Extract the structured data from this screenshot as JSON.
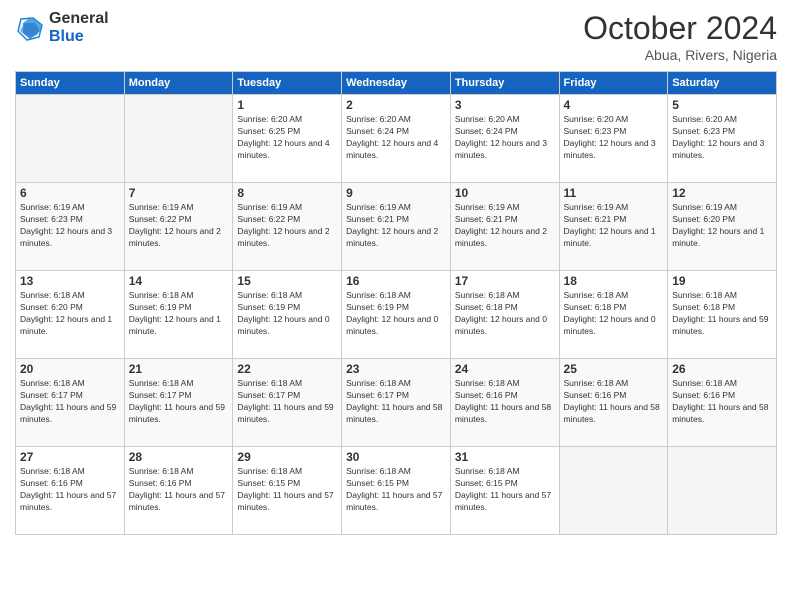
{
  "header": {
    "logo_general": "General",
    "logo_blue": "Blue",
    "month_title": "October 2024",
    "location": "Abua, Rivers, Nigeria"
  },
  "days_of_week": [
    "Sunday",
    "Monday",
    "Tuesday",
    "Wednesday",
    "Thursday",
    "Friday",
    "Saturday"
  ],
  "weeks": [
    [
      {
        "day": "",
        "info": ""
      },
      {
        "day": "",
        "info": ""
      },
      {
        "day": "1",
        "info": "Sunrise: 6:20 AM\nSunset: 6:25 PM\nDaylight: 12 hours and 4 minutes."
      },
      {
        "day": "2",
        "info": "Sunrise: 6:20 AM\nSunset: 6:24 PM\nDaylight: 12 hours and 4 minutes."
      },
      {
        "day": "3",
        "info": "Sunrise: 6:20 AM\nSunset: 6:24 PM\nDaylight: 12 hours and 3 minutes."
      },
      {
        "day": "4",
        "info": "Sunrise: 6:20 AM\nSunset: 6:23 PM\nDaylight: 12 hours and 3 minutes."
      },
      {
        "day": "5",
        "info": "Sunrise: 6:20 AM\nSunset: 6:23 PM\nDaylight: 12 hours and 3 minutes."
      }
    ],
    [
      {
        "day": "6",
        "info": "Sunrise: 6:19 AM\nSunset: 6:23 PM\nDaylight: 12 hours and 3 minutes."
      },
      {
        "day": "7",
        "info": "Sunrise: 6:19 AM\nSunset: 6:22 PM\nDaylight: 12 hours and 2 minutes."
      },
      {
        "day": "8",
        "info": "Sunrise: 6:19 AM\nSunset: 6:22 PM\nDaylight: 12 hours and 2 minutes."
      },
      {
        "day": "9",
        "info": "Sunrise: 6:19 AM\nSunset: 6:21 PM\nDaylight: 12 hours and 2 minutes."
      },
      {
        "day": "10",
        "info": "Sunrise: 6:19 AM\nSunset: 6:21 PM\nDaylight: 12 hours and 2 minutes."
      },
      {
        "day": "11",
        "info": "Sunrise: 6:19 AM\nSunset: 6:21 PM\nDaylight: 12 hours and 1 minute."
      },
      {
        "day": "12",
        "info": "Sunrise: 6:19 AM\nSunset: 6:20 PM\nDaylight: 12 hours and 1 minute."
      }
    ],
    [
      {
        "day": "13",
        "info": "Sunrise: 6:18 AM\nSunset: 6:20 PM\nDaylight: 12 hours and 1 minute."
      },
      {
        "day": "14",
        "info": "Sunrise: 6:18 AM\nSunset: 6:19 PM\nDaylight: 12 hours and 1 minute."
      },
      {
        "day": "15",
        "info": "Sunrise: 6:18 AM\nSunset: 6:19 PM\nDaylight: 12 hours and 0 minutes."
      },
      {
        "day": "16",
        "info": "Sunrise: 6:18 AM\nSunset: 6:19 PM\nDaylight: 12 hours and 0 minutes."
      },
      {
        "day": "17",
        "info": "Sunrise: 6:18 AM\nSunset: 6:18 PM\nDaylight: 12 hours and 0 minutes."
      },
      {
        "day": "18",
        "info": "Sunrise: 6:18 AM\nSunset: 6:18 PM\nDaylight: 12 hours and 0 minutes."
      },
      {
        "day": "19",
        "info": "Sunrise: 6:18 AM\nSunset: 6:18 PM\nDaylight: 11 hours and 59 minutes."
      }
    ],
    [
      {
        "day": "20",
        "info": "Sunrise: 6:18 AM\nSunset: 6:17 PM\nDaylight: 11 hours and 59 minutes."
      },
      {
        "day": "21",
        "info": "Sunrise: 6:18 AM\nSunset: 6:17 PM\nDaylight: 11 hours and 59 minutes."
      },
      {
        "day": "22",
        "info": "Sunrise: 6:18 AM\nSunset: 6:17 PM\nDaylight: 11 hours and 59 minutes."
      },
      {
        "day": "23",
        "info": "Sunrise: 6:18 AM\nSunset: 6:17 PM\nDaylight: 11 hours and 58 minutes."
      },
      {
        "day": "24",
        "info": "Sunrise: 6:18 AM\nSunset: 6:16 PM\nDaylight: 11 hours and 58 minutes."
      },
      {
        "day": "25",
        "info": "Sunrise: 6:18 AM\nSunset: 6:16 PM\nDaylight: 11 hours and 58 minutes."
      },
      {
        "day": "26",
        "info": "Sunrise: 6:18 AM\nSunset: 6:16 PM\nDaylight: 11 hours and 58 minutes."
      }
    ],
    [
      {
        "day": "27",
        "info": "Sunrise: 6:18 AM\nSunset: 6:16 PM\nDaylight: 11 hours and 57 minutes."
      },
      {
        "day": "28",
        "info": "Sunrise: 6:18 AM\nSunset: 6:16 PM\nDaylight: 11 hours and 57 minutes."
      },
      {
        "day": "29",
        "info": "Sunrise: 6:18 AM\nSunset: 6:15 PM\nDaylight: 11 hours and 57 minutes."
      },
      {
        "day": "30",
        "info": "Sunrise: 6:18 AM\nSunset: 6:15 PM\nDaylight: 11 hours and 57 minutes."
      },
      {
        "day": "31",
        "info": "Sunrise: 6:18 AM\nSunset: 6:15 PM\nDaylight: 11 hours and 57 minutes."
      },
      {
        "day": "",
        "info": ""
      },
      {
        "day": "",
        "info": ""
      }
    ]
  ]
}
